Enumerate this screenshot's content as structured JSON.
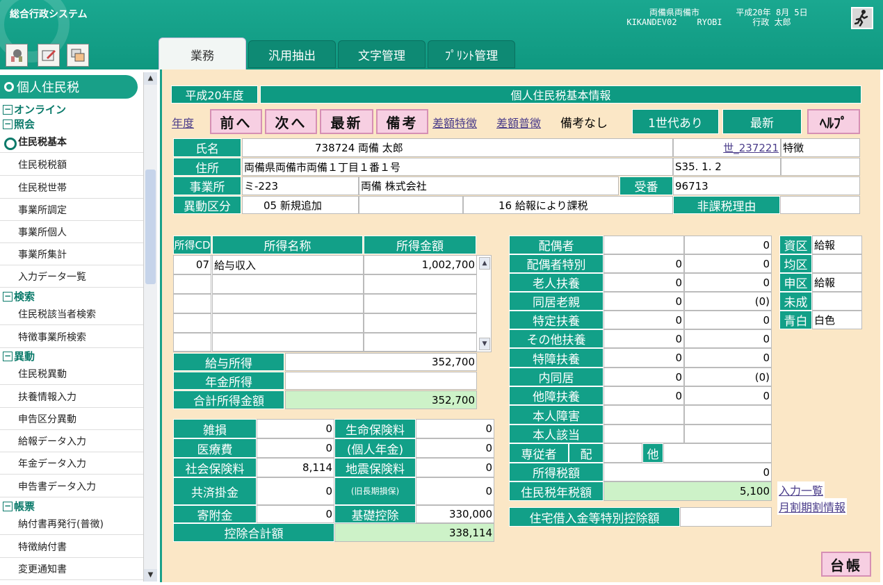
{
  "header": {
    "system_title": "総合行政システム",
    "line1_left": "両備県両備市",
    "line1_right": "平成20年 8月 5日",
    "line2_left": "KIKANDEV02    RYOBI",
    "line2_right": "行政 太郎"
  },
  "toolbar_icons": [
    "tools-icon",
    "edit-icon",
    "windows-icon"
  ],
  "tabs": [
    "業務",
    "汎用抽出",
    "文字管理",
    "ﾌﾟﾘﾝﾄ管理"
  ],
  "sidebar": {
    "title": "個人住民税",
    "sections": {
      "online": "オンライン",
      "inquiry": "照会",
      "search": "検索",
      "change": "異動",
      "ledger": "帳票"
    },
    "inquiry_items": [
      "住民税基本",
      "住民税税額",
      "住民税世帯",
      "事業所調定",
      "事業所個人",
      "事業所集計",
      "入力データ一覧"
    ],
    "search_items": [
      "住民税該当者検索",
      "特徴事業所検索"
    ],
    "change_items": [
      "住民税異動",
      "扶養情報入力",
      "申告区分異動",
      "給報データ入力",
      "年金データ入力",
      "申告書データ入力"
    ],
    "ledger_items": [
      "納付書再発行(普徴)",
      "特徴納付書",
      "変更通知書"
    ]
  },
  "main": {
    "fiscal_year": "平成20年度",
    "panel_title": "個人住民税基本情報",
    "nav": {
      "year_link": "年度",
      "prev": "前へ",
      "next": "次へ",
      "latest": "最新",
      "note": "備考",
      "tokucho_link": "差額特徴",
      "fucho_link": "差額普徴",
      "note_status": "備考なし",
      "household": "1世代あり",
      "latest2": "最新",
      "help": "ﾍﾙﾌﾟ"
    },
    "basic": {
      "name_label": "氏名",
      "name_value": "738724 両備 太郎",
      "household_link": "世_237221",
      "household_type": "特徴",
      "address_label": "住所",
      "address_value": "両備県両備市両備１丁目１番１号",
      "birth": "S35. 1. 2",
      "office_label": "事業所",
      "office_code": "ミ-223",
      "office_name": "両備 株式会社",
      "receipt_label": "受番",
      "receipt_value": "96713",
      "change_label": "異動区分",
      "change_value": "05 新規追加",
      "tax_reason": "16 給報により課税",
      "nontax_label": "非課税理由"
    },
    "income_table": {
      "headers": [
        "所得CD",
        "所得名称",
        "所得金額"
      ],
      "rows": [
        [
          "07",
          "給与収入",
          "1,002,700"
        ],
        [
          "",
          "",
          ""
        ],
        [
          "",
          "",
          ""
        ],
        [
          "",
          "",
          ""
        ],
        [
          "",
          "",
          ""
        ]
      ]
    },
    "income_summary": [
      [
        "給与所得",
        "352,700"
      ],
      [
        "年金所得",
        ""
      ],
      [
        "合計所得金額",
        "352,700"
      ]
    ],
    "deductions": [
      [
        "雑損",
        "0",
        "生命保険料",
        "0"
      ],
      [
        "医療費",
        "0",
        "(個人年金)",
        "0"
      ],
      [
        "社会保険料",
        "8,114",
        "地震保険料",
        "0"
      ],
      [
        "共済掛金",
        "0",
        "(旧長期損保)",
        "0"
      ],
      [
        "寄附金",
        "0",
        "基礎控除",
        "330,000"
      ]
    ],
    "deduction_total_label": "控除合計額",
    "deduction_total": "338,114",
    "dependents": [
      [
        "配偶者",
        "",
        "0"
      ],
      [
        "配偶者特別",
        "0",
        "0"
      ],
      [
        "老人扶養",
        "0",
        "0"
      ],
      [
        "同居老親",
        "0",
        "(0)"
      ],
      [
        "特定扶養",
        "0",
        "0"
      ],
      [
        "その他扶養",
        "0",
        "0"
      ],
      [
        "特障扶養",
        "0",
        "0"
      ],
      [
        "内同居",
        "0",
        "(0)"
      ],
      [
        "他障扶養",
        "0",
        "0"
      ],
      [
        "本人障害",
        "",
        ""
      ],
      [
        "本人該当",
        "",
        ""
      ]
    ],
    "family_worker": {
      "label": "専従者",
      "spouse": "配",
      "other": "他"
    },
    "income_tax_label": "所得税額",
    "income_tax": "0",
    "resident_tax_label": "住民税年税額",
    "resident_tax": "5,100",
    "housing_loan_label": "住宅借入金等特別控除額",
    "housing_loan": "",
    "categories": [
      [
        "資区",
        "給報"
      ],
      [
        "均区",
        ""
      ],
      [
        "申区",
        "給報"
      ],
      [
        "未成",
        ""
      ],
      [
        "青白",
        "白色"
      ]
    ],
    "links": {
      "input_list": "入力一覧",
      "monthly_info": "月割期割情報"
    },
    "ledger_button": "台帳"
  }
}
